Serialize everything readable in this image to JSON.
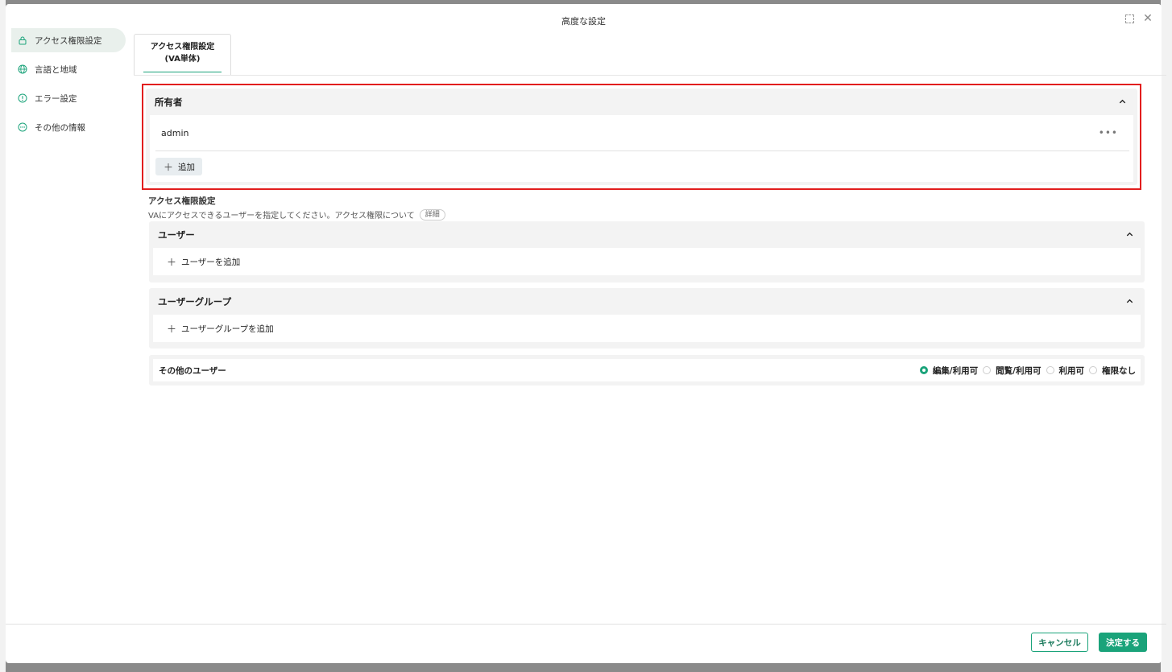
{
  "dialog": {
    "title": "高度な設定"
  },
  "sidebar": {
    "items": [
      {
        "label": "アクセス権限設定",
        "icon": "lock-icon",
        "active": true
      },
      {
        "label": "言語と地域",
        "icon": "globe-icon",
        "active": false
      },
      {
        "label": "エラー設定",
        "icon": "alert-circle-icon",
        "active": false
      },
      {
        "label": "その他の情報",
        "icon": "more-circle-icon",
        "active": false
      }
    ]
  },
  "tab": {
    "line1": "アクセス権限設定",
    "line2": "(VA単体)"
  },
  "owner": {
    "title": "所有者",
    "name": "admin",
    "more": "•••",
    "add_label": "追加"
  },
  "access": {
    "title": "アクセス権限設定",
    "description": "VAにアクセスできるユーザーを指定してください。アクセス権限について",
    "detail_label": "詳細"
  },
  "users": {
    "title": "ユーザー",
    "add_label": "ユーザーを追加"
  },
  "groups": {
    "title": "ユーザーグループ",
    "add_label": "ユーザーグループを追加"
  },
  "other_users": {
    "label": "その他のユーザー",
    "options": [
      "編集/利用可",
      "閲覧/利用可",
      "利用可",
      "権限なし"
    ],
    "selected": "編集/利用可"
  },
  "footer": {
    "cancel_label": "キャンセル",
    "ok_label": "決定する"
  },
  "colors": {
    "accent": "#1aa37a",
    "highlight": "#e21e1e"
  }
}
